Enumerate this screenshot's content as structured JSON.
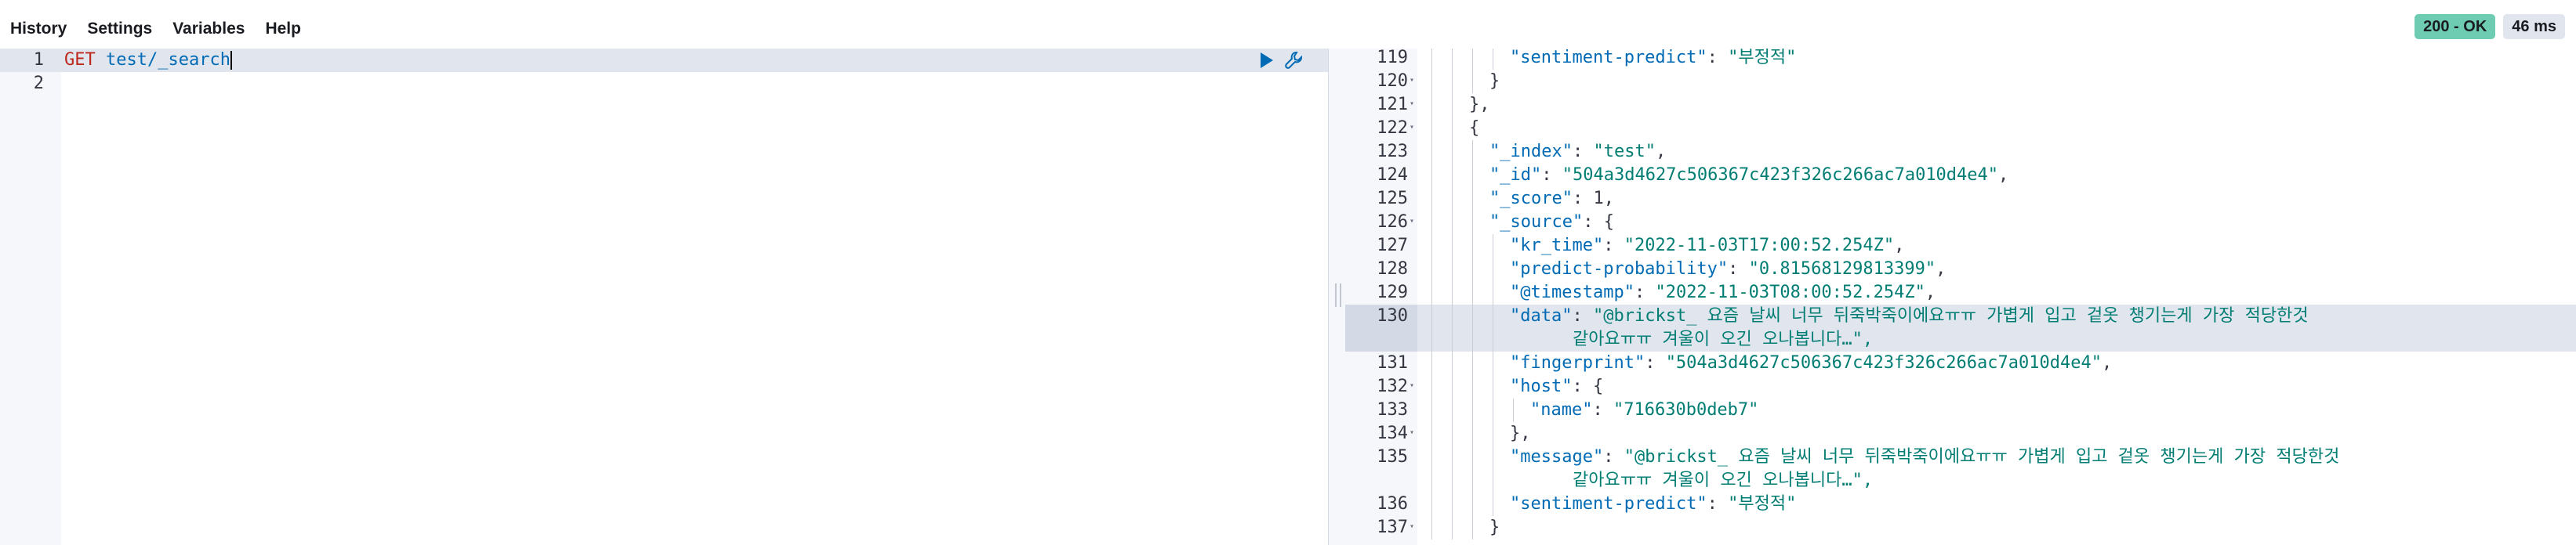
{
  "menu": {
    "history": "History",
    "settings": "Settings",
    "variables": "Variables",
    "help": "Help"
  },
  "status": {
    "code": "200 - OK",
    "time": "46 ms",
    "ok_color": "#6dccb1"
  },
  "request": {
    "lines": [
      {
        "num": "1",
        "method": "GET",
        "path": "test/_search"
      },
      {
        "num": "2",
        "method": "",
        "path": ""
      }
    ],
    "icons": [
      "play-icon",
      "wrench-icon"
    ]
  },
  "response": {
    "lines": [
      {
        "num": "119",
        "fold": false,
        "depth": 4,
        "parts": [
          {
            "t": "k",
            "v": "\"sentiment-predict\""
          },
          {
            "t": "p",
            "v": ": "
          },
          {
            "t": "s",
            "v": "\"부정적\""
          }
        ]
      },
      {
        "num": "120",
        "fold": true,
        "depth": 3,
        "parts": [
          {
            "t": "p",
            "v": "}"
          }
        ]
      },
      {
        "num": "121",
        "fold": true,
        "depth": 2,
        "parts": [
          {
            "t": "p",
            "v": "},"
          }
        ]
      },
      {
        "num": "122",
        "fold": true,
        "depth": 2,
        "parts": [
          {
            "t": "p",
            "v": "{"
          }
        ]
      },
      {
        "num": "123",
        "fold": false,
        "depth": 3,
        "parts": [
          {
            "t": "k",
            "v": "\"_index\""
          },
          {
            "t": "p",
            "v": ": "
          },
          {
            "t": "s",
            "v": "\"test\""
          },
          {
            "t": "p",
            "v": ","
          }
        ]
      },
      {
        "num": "124",
        "fold": false,
        "depth": 3,
        "parts": [
          {
            "t": "k",
            "v": "\"_id\""
          },
          {
            "t": "p",
            "v": ": "
          },
          {
            "t": "s",
            "v": "\"504a3d4627c506367c423f326c266ac7a010d4e4\""
          },
          {
            "t": "p",
            "v": ","
          }
        ]
      },
      {
        "num": "125",
        "fold": false,
        "depth": 3,
        "parts": [
          {
            "t": "k",
            "v": "\"_score\""
          },
          {
            "t": "p",
            "v": ": 1,"
          }
        ]
      },
      {
        "num": "126",
        "fold": true,
        "depth": 3,
        "parts": [
          {
            "t": "k",
            "v": "\"_source\""
          },
          {
            "t": "p",
            "v": ": {"
          }
        ]
      },
      {
        "num": "127",
        "fold": false,
        "depth": 4,
        "parts": [
          {
            "t": "k",
            "v": "\"kr_time\""
          },
          {
            "t": "p",
            "v": ": "
          },
          {
            "t": "s",
            "v": "\"2022-11-03T17:00:52.254Z\""
          },
          {
            "t": "p",
            "v": ","
          }
        ]
      },
      {
        "num": "128",
        "fold": false,
        "depth": 4,
        "parts": [
          {
            "t": "k",
            "v": "\"predict-probability\""
          },
          {
            "t": "p",
            "v": ": "
          },
          {
            "t": "s",
            "v": "\"0.81568129813399\""
          },
          {
            "t": "p",
            "v": ","
          }
        ]
      },
      {
        "num": "129",
        "fold": false,
        "depth": 4,
        "parts": [
          {
            "t": "k",
            "v": "\"@timestamp\""
          },
          {
            "t": "p",
            "v": ": "
          },
          {
            "t": "s",
            "v": "\"2022-11-03T08:00:52.254Z\""
          },
          {
            "t": "p",
            "v": ","
          }
        ]
      },
      {
        "num": "130",
        "fold": false,
        "depth": 4,
        "active": true,
        "parts": [
          {
            "t": "k",
            "v": "\"data\""
          },
          {
            "t": "p",
            "v": ": "
          },
          {
            "t": "s",
            "v": "\"@brickst_ 요즘 날씨 너무 뒤죽박죽이에요ㅠㅠ 가볍게 입고 겉옷 챙기는게 가장 적당한것"
          }
        ],
        "cont": "같아요ㅠㅠ 겨울이 오긴 오나봅니다…\","
      },
      {
        "num": "131",
        "fold": false,
        "depth": 4,
        "parts": [
          {
            "t": "k",
            "v": "\"fingerprint\""
          },
          {
            "t": "p",
            "v": ": "
          },
          {
            "t": "s",
            "v": "\"504a3d4627c506367c423f326c266ac7a010d4e4\""
          },
          {
            "t": "p",
            "v": ","
          }
        ]
      },
      {
        "num": "132",
        "fold": true,
        "depth": 4,
        "parts": [
          {
            "t": "k",
            "v": "\"host\""
          },
          {
            "t": "p",
            "v": ": {"
          }
        ]
      },
      {
        "num": "133",
        "fold": false,
        "depth": 5,
        "parts": [
          {
            "t": "k",
            "v": "\"name\""
          },
          {
            "t": "p",
            "v": ": "
          },
          {
            "t": "s",
            "v": "\"716630b0deb7\""
          }
        ]
      },
      {
        "num": "134",
        "fold": true,
        "depth": 4,
        "parts": [
          {
            "t": "p",
            "v": "},"
          }
        ]
      },
      {
        "num": "135",
        "fold": false,
        "depth": 4,
        "parts": [
          {
            "t": "k",
            "v": "\"message\""
          },
          {
            "t": "p",
            "v": ": "
          },
          {
            "t": "s",
            "v": "\"@brickst_ 요즘 날씨 너무 뒤죽박죽이에요ㅠㅠ 가볍게 입고 겉옷 챙기는게 가장 적당한것"
          }
        ],
        "cont": "같아요ㅠㅠ 겨울이 오긴 오나봅니다…\","
      },
      {
        "num": "136",
        "fold": false,
        "depth": 4,
        "parts": [
          {
            "t": "k",
            "v": "\"sentiment-predict\""
          },
          {
            "t": "p",
            "v": ": "
          },
          {
            "t": "s",
            "v": "\"부정적\""
          }
        ]
      },
      {
        "num": "137",
        "fold": true,
        "depth": 3,
        "parts": [
          {
            "t": "p",
            "v": "}"
          }
        ]
      }
    ]
  }
}
